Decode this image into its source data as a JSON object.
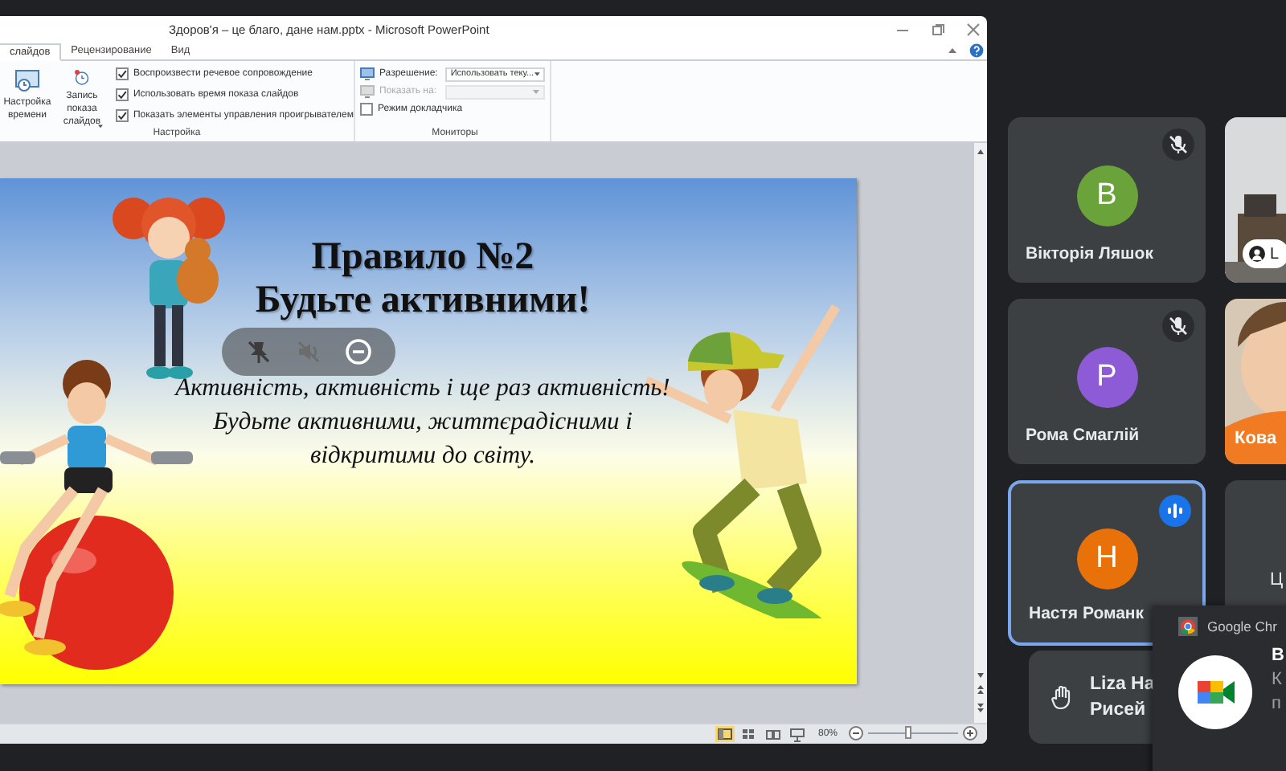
{
  "presentation_window": {
    "title": "Здоров'я – це благо, дане нам.pptx - Microsoft PowerPoint",
    "tabs": [
      {
        "label": "слайдов",
        "selected": true
      },
      {
        "label": "Рецензирование",
        "selected": false
      },
      {
        "label": "Вид",
        "selected": false
      }
    ],
    "setup_group": {
      "label": "Настройка",
      "buttons": [
        {
          "kind": "timing",
          "label": "Настройка времени",
          "dropdown": false
        },
        {
          "kind": "record",
          "label": "Запись показа слайдов",
          "dropdown": true
        }
      ],
      "options": [
        {
          "label": "Воспроизвести речевое сопровождение",
          "checked": true
        },
        {
          "label": "Использовать время показа слайдов",
          "checked": true
        },
        {
          "label": "Показать элементы управления проигрывателем",
          "checked": true
        }
      ]
    },
    "monitors_group": {
      "label": "Мониторы",
      "fields": [
        {
          "label": "Разрешение:",
          "value": "Использовать теку...",
          "disabled": false
        },
        {
          "label": "Показать на:",
          "disabled": true
        }
      ],
      "options": [
        {
          "label": "Режим докладчика",
          "checked": false
        }
      ]
    },
    "slide": {
      "title_lines": [
        "Правило №2",
        "Будьте активними!"
      ],
      "body": [
        "Активність, активність і ще раз активність!",
        "Будьте активними, життєрадісними і відкритими до світу."
      ]
    },
    "status_bar": {
      "views": [
        {
          "kind": "normal",
          "selected": true
        },
        {
          "kind": "sorter",
          "selected": false
        },
        {
          "kind": "reading",
          "selected": false
        },
        {
          "kind": "slideshow",
          "selected": false
        }
      ],
      "zoom": "80%",
      "zoom_slider": {
        "level": 0.45
      }
    }
  },
  "participants": [
    {
      "name": "Вікторія Ляшок",
      "initial": "В",
      "color": "#6aa33a",
      "muted": true,
      "speaking": false
    },
    {
      "name": "Рома Смаглій",
      "initial": "Р",
      "color": "#8e5bd6",
      "muted": true,
      "speaking": false
    },
    {
      "name": "Настя Романк",
      "initial": "Н",
      "color": "#e8710a",
      "muted": false,
      "speaking": true
    }
  ],
  "video_tiles": [
    {
      "kind": "room",
      "name": "L"
    },
    {
      "kind": "person",
      "name": "Кова"
    },
    {
      "kind": "empty",
      "name": "Ц"
    }
  ],
  "raised_hand": {
    "name_lines": [
      "Liza Ha",
      "Рисей"
    ]
  },
  "notification": {
    "app": "Google Chr",
    "title": "В",
    "lines": [
      "К",
      "п"
    ]
  }
}
